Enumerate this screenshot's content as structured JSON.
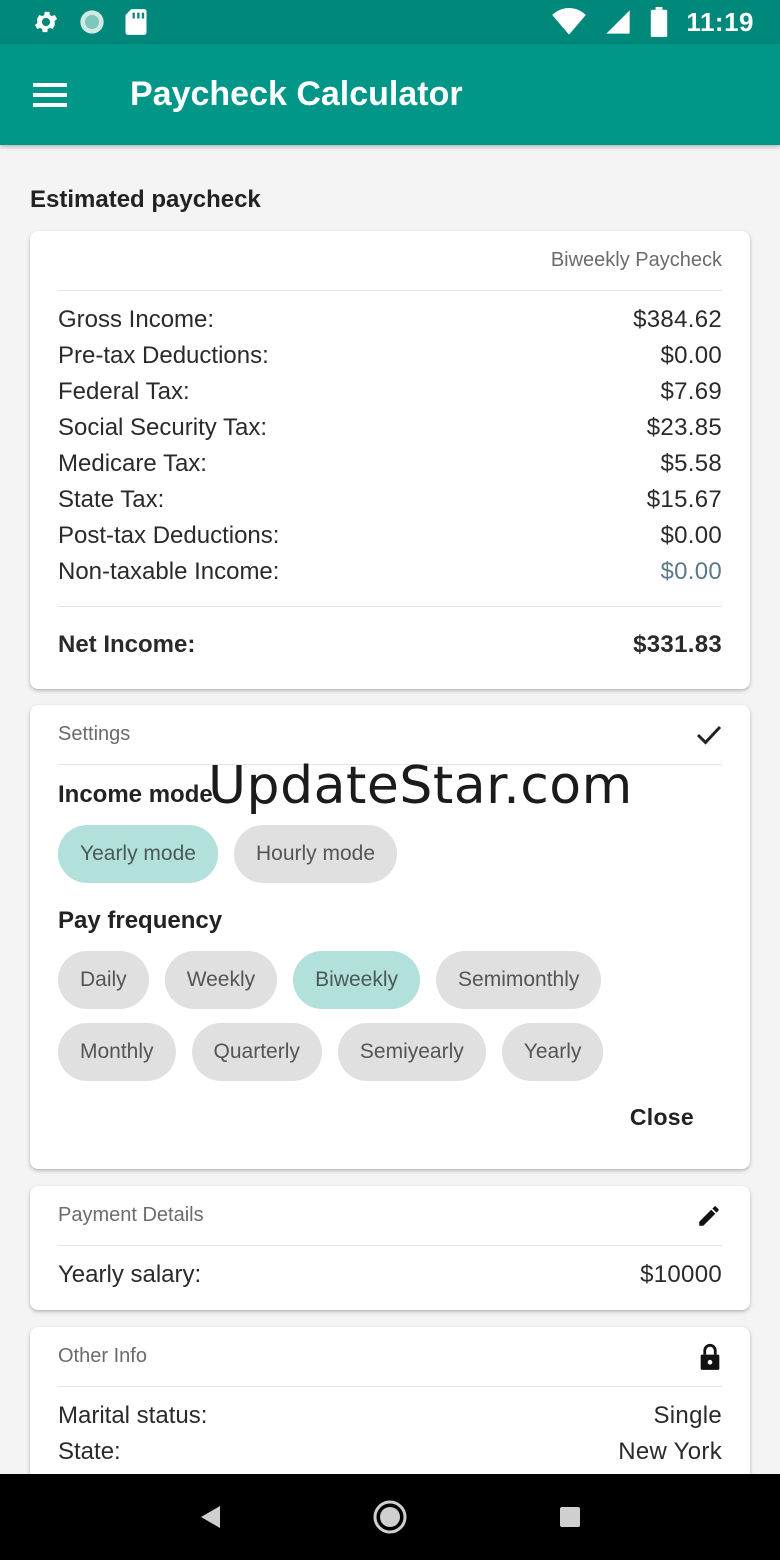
{
  "status_bar": {
    "time": "11:19",
    "icons_left": [
      "gear-icon",
      "circle-icon",
      "sd-card-icon"
    ],
    "icons_right": [
      "wifi-icon",
      "cell-signal-icon",
      "battery-icon"
    ]
  },
  "app_bar": {
    "title": "Paycheck Calculator",
    "menu_icon": "menu-icon"
  },
  "estimated": {
    "heading": "Estimated paycheck",
    "card_title": "Biweekly Paycheck",
    "rows": [
      {
        "label": "Gross Income:",
        "value": "$384.62"
      },
      {
        "label": "Pre-tax Deductions:",
        "value": "$0.00"
      },
      {
        "label": "Federal Tax:",
        "value": "$7.69"
      },
      {
        "label": "Social Security Tax:",
        "value": "$23.85"
      },
      {
        "label": "Medicare Tax:",
        "value": "$5.58"
      },
      {
        "label": "State Tax:",
        "value": "$15.67"
      },
      {
        "label": "Post-tax Deductions:",
        "value": "$0.00"
      },
      {
        "label": "Non-taxable Income:",
        "value": "$0.00"
      }
    ],
    "net_label": "Net Income:",
    "net_value": "$331.83"
  },
  "settings": {
    "title": "Settings",
    "check_icon": "check-icon",
    "income_mode_label": "Income mode",
    "income_modes": [
      {
        "label": "Yearly mode",
        "selected": true
      },
      {
        "label": "Hourly mode",
        "selected": false
      }
    ],
    "pay_frequency_label": "Pay frequency",
    "frequencies_row1": [
      {
        "label": "Daily",
        "selected": false
      },
      {
        "label": "Weekly",
        "selected": false
      },
      {
        "label": "Biweekly",
        "selected": true
      },
      {
        "label": "Semimonthly",
        "selected": false
      }
    ],
    "frequencies_row2": [
      {
        "label": "Monthly",
        "selected": false
      },
      {
        "label": "Quarterly",
        "selected": false
      },
      {
        "label": "Semiyearly",
        "selected": false
      },
      {
        "label": "Yearly",
        "selected": false
      }
    ],
    "close_label": "Close"
  },
  "payment_details": {
    "title": "Payment Details",
    "edit_icon": "pencil-icon",
    "salary_label": "Yearly salary:",
    "salary_value": "$10000"
  },
  "other_info": {
    "title": "Other Info",
    "lock_icon": "lock-icon",
    "marital_label": "Marital status:",
    "marital_value": "Single",
    "state_label": "State:",
    "state_value": "New York"
  },
  "watermark": "UpdateStar.com",
  "colors": {
    "primary": "#009688",
    "primary_dark": "#00897b",
    "chip_selected": "#b2e0da",
    "chip": "#e0e0e0"
  }
}
